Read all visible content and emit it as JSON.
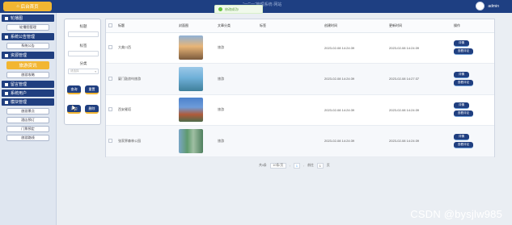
{
  "topbar": {
    "home_label": "后台首页",
    "site_title": "“一”“一”管理系统·网站",
    "username": "admin"
  },
  "toast": {
    "text": "修改成功!"
  },
  "sidebar": {
    "groups": [
      {
        "title": "轮播图",
        "items": [
          {
            "label": "轮播图管理"
          }
        ]
      },
      {
        "title": "系统公告管理",
        "items": [
          {
            "label": "系统公告"
          }
        ]
      },
      {
        "title": "资源管理",
        "items": [
          {
            "label": "旅游资讯",
            "active": true
          },
          {
            "label": "旅游攻略"
          }
        ]
      },
      {
        "title": "留言管理",
        "items": []
      },
      {
        "title": "系统用户",
        "items": []
      },
      {
        "title": "模块管理",
        "items": [
          {
            "label": "旅游景点"
          },
          {
            "label": "酒店预订"
          },
          {
            "label": "门票预定"
          },
          {
            "label": "旅游路线"
          }
        ]
      }
    ]
  },
  "search": {
    "title_label": "标题",
    "tag_label": "标签",
    "category_label": "分类",
    "category_placeholder": "请选择",
    "query_button": "查询",
    "reset_button": "重置",
    "add_button": "添加",
    "delete_button": "删除"
  },
  "table": {
    "headers": [
      "标题",
      "封面图",
      "文章分类",
      "标签",
      "创建时间",
      "更新时间",
      "操作"
    ],
    "rows": [
      {
        "title": "大美川西",
        "category": "旅游",
        "tag": "",
        "created": "2023-02-08 14:24:39",
        "updated": "2023-02-08 14:24:39",
        "thumb_color": "#c98a4a"
      },
      {
        "title": "厦门鼓浪屿旅游",
        "category": "旅游",
        "tag": "",
        "created": "2023-02-08 14:24:39",
        "updated": "2023-02-08 14:27:37",
        "thumb_color": "#5a9bc9"
      },
      {
        "title": "西安雁塔",
        "category": "旅游",
        "tag": "",
        "created": "2023-02-08 14:24:39",
        "updated": "2023-02-08 14:24:39",
        "thumb_color": "#3e6fb8"
      },
      {
        "title": "张家界森林公园",
        "category": "旅游",
        "tag": "",
        "created": "2023-02-08 14:24:39",
        "updated": "2023-02-08 14:24:39",
        "thumb_color": "#5f9a6e"
      }
    ],
    "detail_button": "详情",
    "comment_button": "查看评论"
  },
  "pager": {
    "total": "共4条",
    "page_size": "10条/页",
    "current_page": "1",
    "goto_prefix": "前往",
    "goto_value": "1",
    "goto_suffix": "页"
  },
  "watermark": "CSDN @bysjlw985",
  "colors": {
    "primary": "#203f80",
    "accent": "#f2b632"
  }
}
